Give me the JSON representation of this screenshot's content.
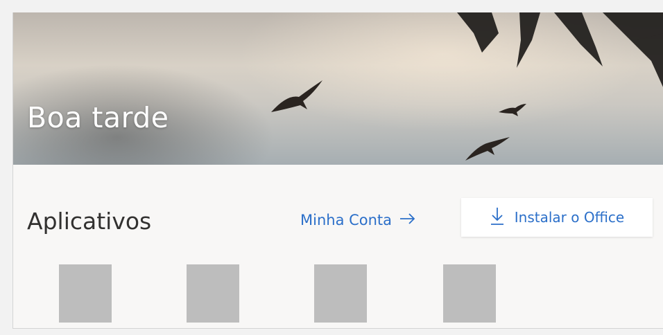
{
  "header": {
    "greeting": "Boa tarde"
  },
  "apps": {
    "title": "Aplicativos",
    "account_link_label": "Minha Conta",
    "install_label": "Instalar o Office",
    "tiles": [
      {
        "name": "app-tile-1"
      },
      {
        "name": "app-tile-2"
      },
      {
        "name": "app-tile-3"
      },
      {
        "name": "app-tile-4"
      }
    ]
  },
  "icons": {
    "account_link": "arrow-right-icon",
    "install": "download-icon"
  },
  "colors": {
    "link": "#2b6fc9",
    "tile_placeholder": "#bdbdbd",
    "title_text": "#323130"
  }
}
